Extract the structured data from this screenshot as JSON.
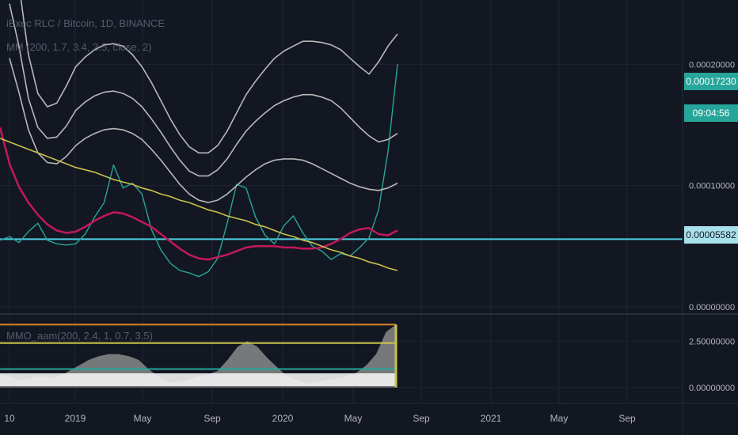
{
  "chart_data": [
    {
      "type": "line",
      "title": "iExec RLC / Bitcoin, 1D, BINANCE",
      "indicator_label": "MM (200, 1.7, 3.4, 3.5, close, 2)",
      "x": [
        "10",
        "2019",
        "May",
        "Sep",
        "2020",
        "May",
        "Sep",
        "2021",
        "May",
        "Sep"
      ],
      "price_axis": [
        "0.00020000",
        "0.00010000",
        "0.00000000"
      ],
      "ylim": [
        0.0,
        0.00024
      ],
      "series": [
        {
          "color": "#26a69a",
          "values": [
            5.5e-05,
            5.8e-05,
            5.3e-05,
            6.2e-05,
            6.9e-05,
            5.5e-05,
            5.2e-05,
            5.1e-05,
            5.2e-05,
            6e-05,
            7.4e-05,
            8.6e-05,
            0.000117,
            9.8e-05,
            0.000102,
            9.3e-05,
            6.4e-05,
            4.7e-05,
            3.6e-05,
            3e-05,
            2.8e-05,
            2.5e-05,
            2.9e-05,
            4e-05,
            6.9e-05,
            0.000101,
            9.8e-05,
            7.4e-05,
            5.9e-05,
            5.2e-05,
            6.7e-05,
            7.5e-05,
            6.1e-05,
            5e-05,
            4.6e-05,
            3.9e-05,
            4.4e-05,
            4.2e-05,
            4.9e-05,
            5.7e-05,
            8e-05,
            0.000128,
            0.0002
          ]
        },
        {
          "color": "#c2185b",
          "values": [
            0.000148,
            0.000118,
            9.9e-05,
            8.6e-05,
            7.6e-05,
            6.8e-05,
            6.3e-05,
            6.1e-05,
            6.2e-05,
            6.6e-05,
            7.1e-05,
            7.5e-05,
            7.8e-05,
            7.7e-05,
            7.4e-05,
            7e-05,
            6.6e-05,
            6e-05,
            5.4e-05,
            4.8e-05,
            4.3e-05,
            4e-05,
            3.9e-05,
            4.1e-05,
            4.3e-05,
            4.6e-05,
            4.9e-05,
            5e-05,
            5e-05,
            5e-05,
            4.9e-05,
            4.9e-05,
            4.8e-05,
            4.8e-05,
            4.9e-05,
            5.2e-05,
            5.6e-05,
            6.1e-05,
            6.4e-05,
            6.5e-05,
            6e-05,
            5.9e-05,
            6.3e-05
          ]
        },
        {
          "color": "#b8b8b8",
          "values": [
            null,
            0.00031,
            0.000266,
            0.000208,
            0.000176,
            0.000165,
            0.000168,
            0.000182,
            0.000198,
            0.000206,
            0.000212,
            0.000216,
            0.000217,
            0.000215,
            0.000208,
            0.000198,
            0.000185,
            0.00017,
            0.000155,
            0.000142,
            0.000132,
            0.000127,
            0.000127,
            0.000133,
            0.000145,
            0.00016,
            0.000175,
            0.000186,
            0.000196,
            0.000205,
            0.000211,
            0.000215,
            0.000219,
            0.000219,
            0.000218,
            0.000216,
            0.000212,
            0.000205,
            0.000198,
            0.000192,
            0.000202,
            0.000215,
            0.000225
          ]
        },
        {
          "color": "#b8b8b8",
          "values": [
            null,
            0.00025,
            0.000215,
            0.000172,
            0.000148,
            0.000139,
            0.00014,
            0.000149,
            0.000162,
            0.000169,
            0.000174,
            0.000177,
            0.000178,
            0.000176,
            0.000172,
            0.000165,
            0.000155,
            0.000144,
            0.000132,
            0.000121,
            0.000112,
            0.000108,
            0.000108,
            0.000113,
            0.000122,
            0.000134,
            0.000145,
            0.000153,
            0.00016,
            0.000166,
            0.00017,
            0.000173,
            0.000175,
            0.000175,
            0.000173,
            0.00017,
            0.000164,
            0.000156,
            0.000148,
            0.000141,
            0.000136,
            0.000138,
            0.000143
          ]
        },
        {
          "color": "#b8b8b8",
          "values": [
            null,
            0.000205,
            0.000177,
            0.000146,
            0.000127,
            0.000119,
            0.000118,
            0.000124,
            0.000133,
            0.000139,
            0.000143,
            0.000146,
            0.000147,
            0.000146,
            0.000143,
            0.000138,
            0.00013,
            0.000121,
            0.000111,
            0.000101,
            9.3e-05,
            8.8e-05,
            8.6e-05,
            8.8e-05,
            9.3e-05,
            0.0001,
            0.000107,
            0.000113,
            0.000118,
            0.000121,
            0.000122,
            0.000122,
            0.000121,
            0.000118,
            0.000114,
            0.00011,
            0.000106,
            0.000102,
            9.9e-05,
            9.7e-05,
            9.6e-05,
            9.8e-05,
            0.000102
          ]
        },
        {
          "color": "#c9c24a",
          "values": [
            0.000139,
            0.000136,
            0.000133,
            0.00013,
            0.000127,
            0.000124,
            0.000121,
            0.000118,
            0.000115,
            0.000113,
            0.000111,
            0.000108,
            0.000105,
            0.000103,
            0.000101,
            9.8e-05,
            9.6e-05,
            9.3e-05,
            9.1e-05,
            8.8e-05,
            8.6e-05,
            8.3e-05,
            8e-05,
            7.8e-05,
            7.5e-05,
            7.3e-05,
            7.1e-05,
            6.8e-05,
            6.6e-05,
            6.3e-05,
            6e-05,
            5.8e-05,
            5.5e-05,
            5.3e-05,
            5e-05,
            4.7e-05,
            4.5e-05,
            4.2e-05,
            4e-05,
            3.7e-05,
            3.5e-05,
            3.2e-05,
            3e-05
          ]
        }
      ],
      "horizontal_line": {
        "value": 5.582e-05,
        "color": "#4dd0e1"
      },
      "labels": {
        "last_price": "0.00017230",
        "countdown": "09:04:56",
        "line_price": "0.00005582"
      }
    },
    {
      "type": "area",
      "title": "MMO_aam(200, 2.4, 1, 0.7, 3.5)",
      "price_axis": [
        "2.50000000",
        "0.00000000"
      ],
      "ylim": [
        0.0,
        3.5
      ],
      "series": [
        {
          "color": "#8a8a8a",
          "values": [
            0.7,
            0.6,
            0.4,
            0.5,
            0.6,
            0.5,
            0.6,
            0.9,
            1.2,
            1.5,
            1.7,
            1.8,
            1.8,
            1.7,
            1.5,
            1.0,
            0.6,
            0.3,
            0.3,
            0.4,
            0.6,
            0.7,
            0.9,
            1.5,
            2.2,
            2.5,
            2.2,
            1.6,
            1.1,
            0.6,
            0.4,
            0.2,
            0.3,
            0.4,
            0.5,
            0.6,
            0.8,
            1.2,
            1.8,
            3.0,
            3.4
          ]
        }
      ],
      "levels": [
        {
          "value": 3.4,
          "color": "#d4832a"
        },
        {
          "value": 2.4,
          "color": "#c9c24a"
        },
        {
          "value": 1.0,
          "color": "#26a69a"
        }
      ]
    }
  ]
}
